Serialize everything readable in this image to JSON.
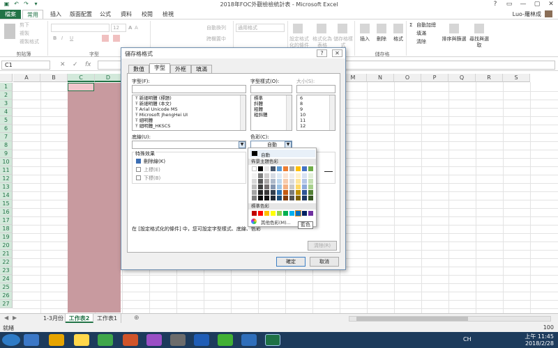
{
  "window": {
    "title": "2018年FOC外觀檢檢統計表 - Microsoft Excel",
    "controls": [
      "?",
      "▭",
      "—",
      "▢",
      "✕"
    ]
  },
  "ribbon_tabs": [
    {
      "label": "檔案"
    },
    {
      "label": "常用"
    },
    {
      "label": "插入"
    },
    {
      "label": "版面配置"
    },
    {
      "label": "公式"
    },
    {
      "label": "資料"
    },
    {
      "label": "校閱"
    },
    {
      "label": "檢視"
    }
  ],
  "user": {
    "name": "Luo-羅林成"
  },
  "ribbon": {
    "cut": "剪下",
    "copy": "複製",
    "format_painter": "複製格式",
    "font_size": "12",
    "wrap_text": "自動換列",
    "merge_center": "跨欄置中",
    "number_format": "通用格式",
    "conditional_format": "設定格式化的條件",
    "format_as_table": "格式化為表格",
    "cell_styles": "儲存格樣式",
    "insert": "插入",
    "delete": "刪除",
    "format": "格式",
    "autosum": "自動加總",
    "fill": "填滿",
    "clear": "清除",
    "sort_filter": "排序與篩選",
    "find_select": "尋找與選取",
    "groups": {
      "clipboard": "剪貼簿",
      "font": "字型",
      "cells": "儲存格"
    }
  },
  "namebox": {
    "value": "C1"
  },
  "formula_bar": {
    "cancel": "✕",
    "enter": "✓",
    "fx": "fx"
  },
  "columns": [
    "A",
    "B",
    "C",
    "D",
    "E",
    "F",
    "G",
    "H",
    "I",
    "J",
    "K",
    "L",
    "M",
    "N",
    "O",
    "P",
    "Q",
    "R",
    "S"
  ],
  "rows": [
    "1",
    "2",
    "3",
    "4",
    "5",
    "6",
    "7",
    "8",
    "9",
    "10",
    "11",
    "12",
    "13",
    "14",
    "15",
    "16",
    "17",
    "18",
    "19",
    "20",
    "21",
    "22",
    "23",
    "24",
    "25",
    "26",
    "27"
  ],
  "sheets": {
    "tabs": [
      "1-3月份",
      "工作表2",
      "工作表1"
    ],
    "active": "工作表2",
    "add": "⊕"
  },
  "status": {
    "ready": "就緒",
    "zoom": "100"
  },
  "taskbar": {
    "time": "上午 11:45",
    "date": "2018/2/28",
    "ime": "CH"
  },
  "dialog": {
    "title": "儲存格格式",
    "help": "?",
    "close": "✕",
    "tabs": [
      "數值",
      "字型",
      "外框",
      "填滿"
    ],
    "active_tab": "字型",
    "font_label": "字型(F):",
    "font_value": "",
    "font_list": [
      "新細明體 (標題)",
      "新細明體 (本文)",
      "Arial Unicode MS",
      "Microsoft JhengHei UI",
      "細明體",
      "細明體_HKSCS"
    ],
    "style_label": "字型樣式(O):",
    "style_value": "",
    "style_list": [
      "標準",
      "斜體",
      "粗體",
      "粗斜體"
    ],
    "size_label": "大小(S):",
    "size_value": "",
    "size_list": [
      "6",
      "8",
      "9",
      "10",
      "11",
      "12"
    ],
    "underline_label": "底線(U):",
    "underline_value": "",
    "color_label": "色彩(C):",
    "color_value": "自動",
    "effects_label": "特殊效果",
    "effects": [
      {
        "label": "刪除線(K)",
        "checked": true
      },
      {
        "label": "上標(E)",
        "checked": false
      },
      {
        "label": "下標(B)",
        "checked": false
      }
    ],
    "note": "在 [設定格式化的條件] 中，您可設定字型樣式、底線、色彩",
    "clear_button": "清除(R)",
    "ok_button": "確定",
    "cancel_button": "取消"
  },
  "color_popup": {
    "automatic": "自動",
    "theme_header": "佈景主題色彩",
    "standard_header": "標準色彩",
    "more_colors": "其他色彩(M)...",
    "tooltip": "藍色",
    "theme_colors": [
      [
        "#ffffff",
        "#000000",
        "#e7e6e6",
        "#44546a",
        "#5b9bd5",
        "#ed7d31",
        "#a5a5a5",
        "#ffc000",
        "#4472c4",
        "#70ad47"
      ],
      [
        "#f2f2f2",
        "#7f7f7f",
        "#d0cece",
        "#d6dce4",
        "#deebf6",
        "#fbe5d5",
        "#ededed",
        "#fff2cc",
        "#d9e2f3",
        "#e2efd9"
      ],
      [
        "#d8d8d8",
        "#595959",
        "#aeabab",
        "#adb9ca",
        "#bdd7ee",
        "#f7cbac",
        "#dbdbdb",
        "#fee599",
        "#b4c6e7",
        "#c5e0b3"
      ],
      [
        "#bfbfbf",
        "#3f3f3f",
        "#757070",
        "#8496b0",
        "#9cc3e5",
        "#f4b183",
        "#c9c9c9",
        "#ffd965",
        "#8eaadb",
        "#a8d08d"
      ],
      [
        "#a5a5a5",
        "#262626",
        "#3a3838",
        "#323f4f",
        "#2e75b5",
        "#c55a11",
        "#7b7b7b",
        "#bf9000",
        "#2f5496",
        "#538135"
      ],
      [
        "#7f7f7f",
        "#0c0c0c",
        "#171616",
        "#222a35",
        "#1e4e79",
        "#833c0b",
        "#525252",
        "#7f6000",
        "#1f3864",
        "#375623"
      ]
    ],
    "standard_colors": [
      "#c00000",
      "#ff0000",
      "#ffc000",
      "#ffff00",
      "#92d050",
      "#00b050",
      "#00b0f0",
      "#0070c0",
      "#002060",
      "#7030a0"
    ]
  }
}
